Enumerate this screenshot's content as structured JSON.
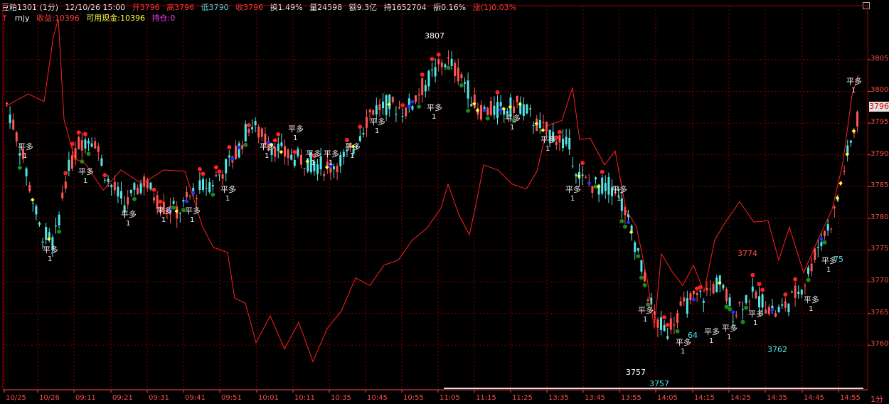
{
  "header": {
    "symbol": "豆粕1301 (1分)",
    "datetime": "12/10/26 15:00",
    "open": "开3796",
    "high": "高3796",
    "low": "低3790",
    "close": "收3796",
    "turnover": "换1.49%",
    "volume": "量24598",
    "amount": "额9.3亿",
    "position": "持1652704",
    "amplitude": "振0.16%",
    "change": "涨(1)0.03%"
  },
  "indicator": {
    "name": "rnjy",
    "profit": "收益:10396",
    "cash": "可用现金:10396",
    "holding": "持仓:0"
  },
  "price_axis": {
    "labels": [
      "3805",
      "3800",
      "3795",
      "3790",
      "3785",
      "3780",
      "3775",
      "3770",
      "3765",
      "3760"
    ],
    "current": "3796"
  },
  "time_axis": {
    "labels": [
      "10/25",
      "10/26",
      "09:11",
      "09:21",
      "09:31",
      "09:41",
      "09:51",
      "10:01",
      "10:11",
      "10:35",
      "10:45",
      "10:55",
      "11:05",
      "11:15",
      "11:25",
      "13:35",
      "13:45",
      "13:55",
      "14:05",
      "14:15",
      "14:25",
      "14:35",
      "14:45",
      "14:55"
    ],
    "period": "1分"
  },
  "annotations": {
    "high_mark": "3807",
    "low_mark1": "3757",
    "low_mark2": "3757",
    "mark_3774": "3774",
    "mark_3764": "64",
    "mark_3762": "3762",
    "mark_75": "75"
  },
  "colors": {
    "background": "#000000",
    "grid": "#8b0000",
    "up": "#ff5555",
    "down": "#55e5e5",
    "line": "#ff2222"
  }
}
